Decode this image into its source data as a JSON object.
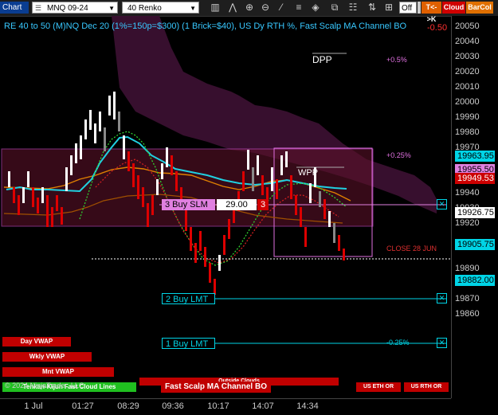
{
  "toolbar": {
    "chart_label": "Chart",
    "instrument": "MNQ 09-24",
    "bar_type": "40 Renko",
    "off_label": "Off",
    "tk_label": "T<->K",
    "cloud_label": "Cloud",
    "barcol_label": "BarCol"
  },
  "chart": {
    "title": "RE 40 to 50 (M)NQ Dec 20 (1%=150p=$300) (1 Brick=$40), US Dy RTH %, Fast Scalp MA Channel BO",
    "corner_value": "-0.50",
    "labels": {
      "dpp": "DPP",
      "wpp": "WPP",
      "pct_top": "+0.5%",
      "pct_mid": "+0.25%",
      "pct_low": "-0.25%",
      "close_label": "CLOSE 28 JUN",
      "buy_slm": "3 Buy SLM",
      "buy_slm_price": "29.00",
      "buy_slm_qty": "3",
      "buy_lmt2": "2 Buy LMT",
      "buy_lmt1": "1 Buy LMT"
    },
    "bottom_buttons": {
      "day_vwap": "Day VWAP",
      "wkly_vwap": "Wkly VWAP",
      "mnt_vwap": "Mnt VWAP",
      "cloud_lines": "Tenkan-Kijun Fast Cloud Lines",
      "copyright": "© 2024 NinjaTrader, LLC",
      "outside_clouds": "Outside Clouds",
      "fast_scalp": "Fast Scalp MA Channel BO",
      "us_eth_or": "US ETH OR",
      "us_rth_or": "US RTH OR"
    },
    "colors": {
      "title": "#38c8ff",
      "up_brick": "#ffffff",
      "down_brick": "#dd0000",
      "accent_cyan": "#00e5ff",
      "magenta": "#e070e0"
    }
  },
  "y_axis": {
    "ticks": [
      20050,
      20040,
      20030,
      20020,
      20010,
      20000,
      19990,
      19980,
      19970,
      19940,
      19930,
      19920,
      19890,
      19880,
      19870,
      19860
    ],
    "flags": [
      {
        "value": "19963.95",
        "bg": "#00d4e6",
        "fg": "#000"
      },
      {
        "value": "19955.50",
        "bg": "#e080e0",
        "fg": "#000"
      },
      {
        "value": "19949.53",
        "bg": "#cc0000",
        "fg": "#fff"
      },
      {
        "value": "19926.75",
        "bg": "#ffffff",
        "fg": "#000"
      },
      {
        "value": "19905.75",
        "bg": "#00d4e6",
        "fg": "#000"
      },
      {
        "value": "19882.00",
        "bg": "#00d4e6",
        "fg": "#000"
      }
    ]
  },
  "x_axis": {
    "ticks": [
      "1 Jul",
      "01:27",
      "08:29",
      "09:36",
      "10:17",
      "14:07",
      "14:34"
    ]
  }
}
